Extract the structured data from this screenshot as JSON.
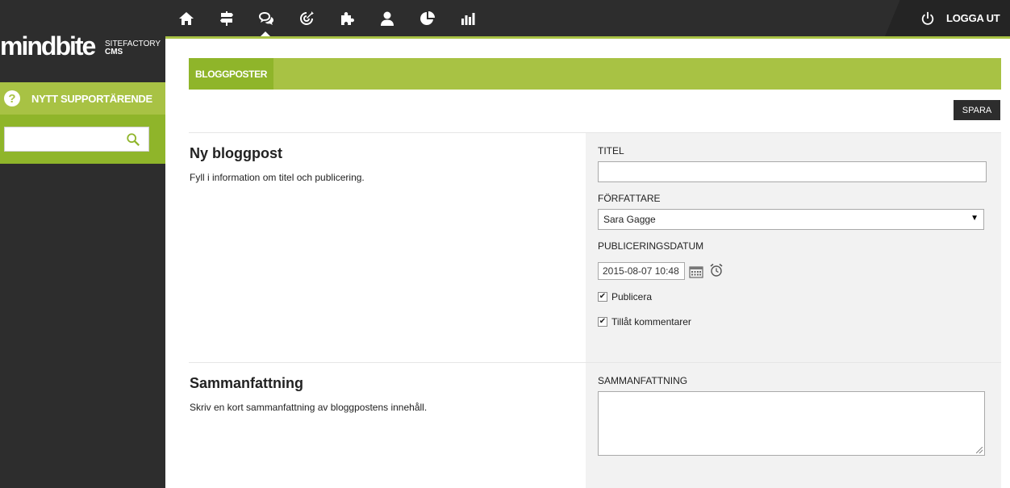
{
  "header": {
    "nav_icons": [
      "home-icon",
      "signpost-icon",
      "chat-bubbles-icon",
      "target-icon",
      "puzzle-icon",
      "user-icon",
      "pie-chart-icon",
      "bar-chart-icon"
    ],
    "active_icon": "chat-bubbles-icon",
    "logout_label": "LOGGA UT",
    "logout_icon": "power-icon"
  },
  "sidebar": {
    "logo_main": "mindbite",
    "logo_sub1": "SITEFACTORY",
    "logo_sub2": "CMS",
    "support_label": "NYTT SUPPORTÄRENDE",
    "support_icon": "question-icon",
    "search_placeholder": "",
    "search_icon": "search-icon"
  },
  "main": {
    "tab_label": "BLOGGPOSTER",
    "save_label": "SPARA",
    "sections": [
      {
        "title": "Ny bloggpost",
        "description": "Fyll i information om titel och publicering.",
        "fields": {
          "title_label": "TITEL",
          "title_value": "",
          "author_label": "FÖRFATTARE",
          "author_value": "Sara Gagge",
          "pubdate_label": "PUBLICERINGSDATUM",
          "pubdate_value": "2015-08-07 10:48",
          "publish_label": "Publicera",
          "publish_checked": true,
          "comments_label": "Tillåt kommentarer",
          "comments_checked": true
        }
      },
      {
        "title": "Sammanfattning",
        "description": "Skriv en kort sammanfattning av bloggpostens innehåll.",
        "fields": {
          "summary_label": "SAMMANFATTNING",
          "summary_value": ""
        }
      }
    ]
  },
  "colors": {
    "accent": "#a8c244",
    "accent_dark": "#8fb52a",
    "dark": "#2d2d2d",
    "panel": "#f2f2f2"
  }
}
